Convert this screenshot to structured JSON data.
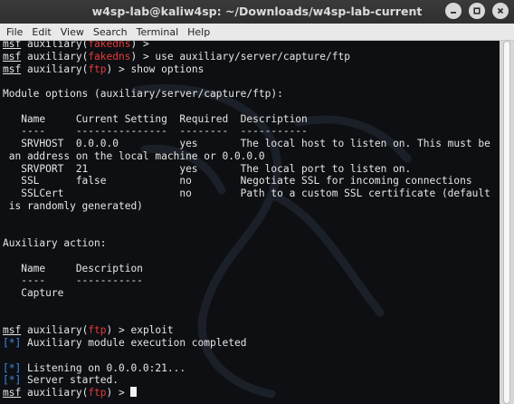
{
  "window": {
    "title": "w4sp-lab@kaliw4sp: ~/Downloads/w4sp-lab-current"
  },
  "window_buttons": [
    "minimize-icon",
    "maximize-icon",
    "close-icon"
  ],
  "menu": [
    "File",
    "Edit",
    "View",
    "Search",
    "Terminal",
    "Help"
  ],
  "colors": {
    "prompt_module": "#e33b3b",
    "status_marker": "#3f8fe6",
    "terminal_bg": "#0d0f12",
    "text": "#e6e6e6"
  },
  "terminal": {
    "lines": [
      [
        {
          "t": "msf",
          "c": "msf"
        },
        {
          "t": " auxiliary("
        },
        {
          "t": "fakedns",
          "c": "red"
        },
        {
          "t": ") >"
        }
      ],
      [
        {
          "t": "msf",
          "c": "msf"
        },
        {
          "t": " auxiliary("
        },
        {
          "t": "fakedns",
          "c": "red"
        },
        {
          "t": ") > use auxiliary/server/capture/ftp"
        }
      ],
      [
        {
          "t": "msf",
          "c": "msf"
        },
        {
          "t": " auxiliary("
        },
        {
          "t": "ftp",
          "c": "red"
        },
        {
          "t": ") > show options"
        }
      ],
      [],
      [
        {
          "t": "Module options (auxiliary/server/capture/ftp):"
        }
      ],
      [],
      [
        {
          "t": "   Name     Current Setting  Required  Description"
        }
      ],
      [
        {
          "t": "   ----     ---------------  --------  -----------"
        }
      ],
      [
        {
          "t": "   SRVHOST  0.0.0.0          yes       The local host to listen on. This must be"
        }
      ],
      [
        {
          "t": " an address on the local machine or 0.0.0.0"
        }
      ],
      [
        {
          "t": "   SRVPORT  21               yes       The local port to listen on."
        }
      ],
      [
        {
          "t": "   SSL      false            no        Negotiate SSL for incoming connections"
        }
      ],
      [
        {
          "t": "   SSLCert                   no        Path to a custom SSL certificate (default"
        }
      ],
      [
        {
          "t": " is randomly generated)"
        }
      ],
      [],
      [],
      [
        {
          "t": "Auxiliary action:"
        }
      ],
      [],
      [
        {
          "t": "   Name     Description"
        }
      ],
      [
        {
          "t": "   ----     -----------"
        }
      ],
      [
        {
          "t": "   Capture"
        }
      ],
      [],
      [],
      [
        {
          "t": "msf",
          "c": "msf"
        },
        {
          "t": " auxiliary("
        },
        {
          "t": "ftp",
          "c": "red"
        },
        {
          "t": ") > exploit"
        }
      ],
      [
        {
          "t": "[*]",
          "c": "blue"
        },
        {
          "t": " Auxiliary module execution completed"
        }
      ],
      [],
      [
        {
          "t": "[*]",
          "c": "blue"
        },
        {
          "t": " Listening on 0.0.0.0:21..."
        }
      ],
      [
        {
          "t": "[*]",
          "c": "blue"
        },
        {
          "t": " Server started."
        }
      ],
      [
        {
          "t": "msf",
          "c": "msf"
        },
        {
          "t": " auxiliary("
        },
        {
          "t": "ftp",
          "c": "red"
        },
        {
          "t": ") > "
        },
        {
          "t": "",
          "c": "cursor"
        }
      ]
    ]
  }
}
